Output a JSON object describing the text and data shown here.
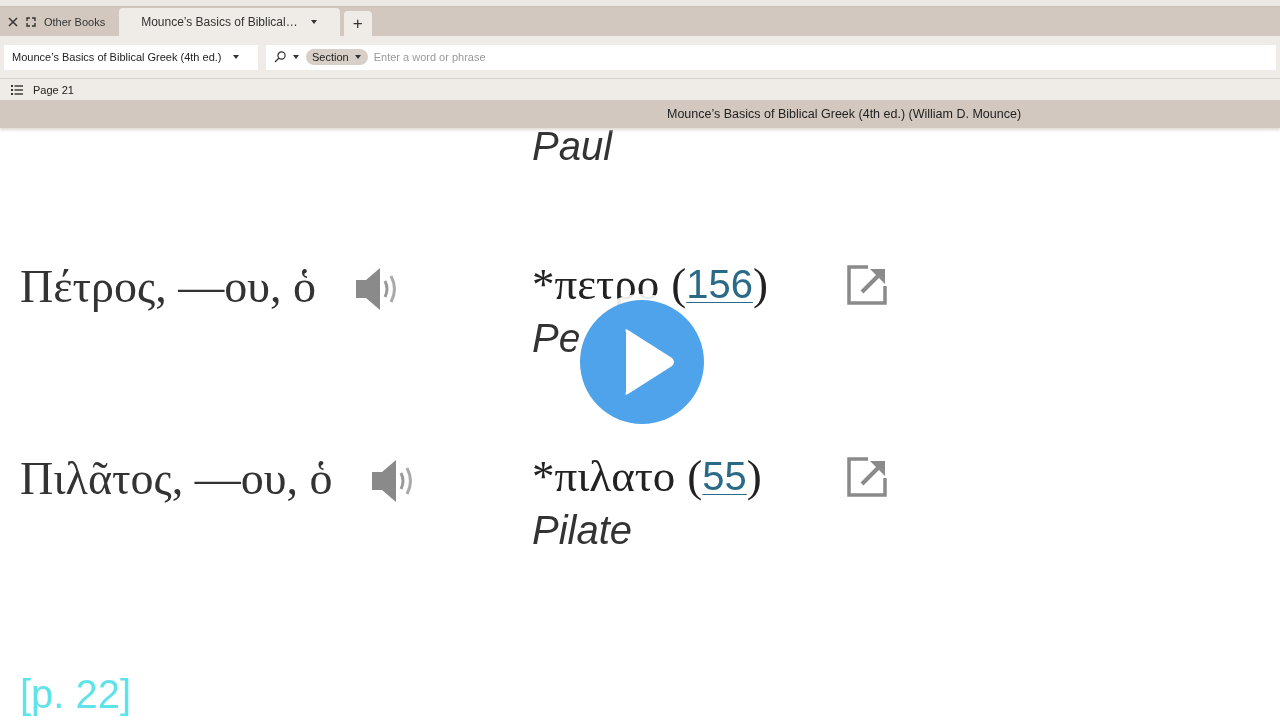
{
  "tabs": [
    {
      "label": "Other Books",
      "kind": "group",
      "selected": false
    },
    {
      "label": "Mounce’s Basics of Biblical…",
      "kind": "document",
      "selected": true
    }
  ],
  "new_tab": "+",
  "toolbar": {
    "resource": "Mounce’s Basics of Biblical Greek (4th ed.)",
    "search_scope": "Section",
    "placeholder": "Enter a word or phrase"
  },
  "location": "Page 21",
  "resource_title": "Mounce’s Basics of Biblical Greek (4th ed.) (William D. Mounce)",
  "entries": [
    {
      "gloss": "Paul"
    },
    {
      "headword": "Πέτρος, —ου, ὁ",
      "lexical_form": "*πετρο",
      "open_paren": "(",
      "frequency": "156",
      "close_paren": ")",
      "gloss": "Pe"
    },
    {
      "headword": "Πιλᾶτος, —ου, ὁ",
      "lexical_form": "*πιλατο",
      "open_paren": "(",
      "frequency": "55",
      "close_paren": ")",
      "gloss": "Pilate"
    }
  ],
  "page_marker": "[p. 22]"
}
